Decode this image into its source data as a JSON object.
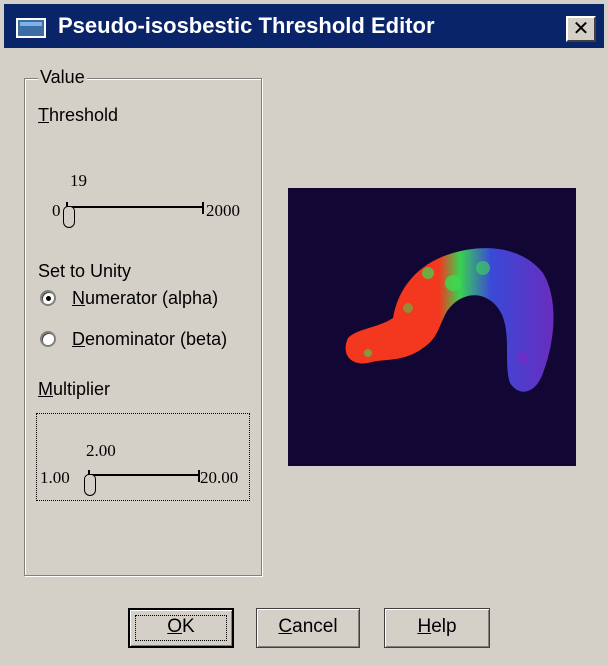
{
  "window": {
    "title": "Pseudo-isosbestic Threshold Editor",
    "close_glyph": "✕"
  },
  "value_group": {
    "legend": "Value",
    "threshold": {
      "label_mnemonic": "T",
      "label_rest": "hreshold",
      "value": "19",
      "min": "0",
      "max": "2000",
      "current": 19
    },
    "set_to_unity": {
      "label": "Set to Unity",
      "options": [
        {
          "mnemonic": "N",
          "rest": "umerator (alpha)",
          "checked": true
        },
        {
          "mnemonic": "D",
          "rest": "enominator (beta)",
          "checked": false
        }
      ]
    },
    "multiplier": {
      "label_mnemonic": "M",
      "label_rest": "ultiplier",
      "value": "2.00",
      "min": "1.00",
      "max": "20.00",
      "current": 2.0
    }
  },
  "buttons": {
    "ok": {
      "mnemonic": "O",
      "rest": "K"
    },
    "cancel": {
      "mnemonic": "C",
      "rest": "ancel"
    },
    "help": {
      "mnemonic": "H",
      "rest": "elp"
    }
  },
  "colors": {
    "title_bar": "#0a246a",
    "dialog_bg": "#d4d0c8",
    "preview_bg": "#120734",
    "blob_red": "#ff3a1e",
    "blob_green": "#3bdc52",
    "blob_blue": "#3c4de0",
    "blob_purple": "#6e2fc6"
  }
}
